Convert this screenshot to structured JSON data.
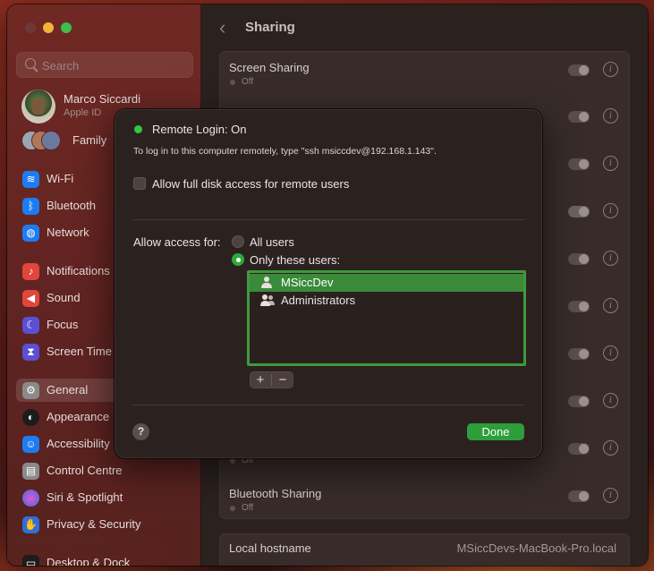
{
  "window": {
    "traffic_lights": [
      "close",
      "minimize",
      "zoom"
    ]
  },
  "sidebar": {
    "search_placeholder": "Search",
    "profile": {
      "name": "Marco Siccardi",
      "subtitle": "Apple ID"
    },
    "family_label": "Family",
    "items": [
      {
        "label": "Wi-Fi",
        "icon": "wifi-icon",
        "color": "#1e7cf2"
      },
      {
        "label": "Bluetooth",
        "icon": "bluetooth-icon",
        "color": "#1e7cf2"
      },
      {
        "label": "Network",
        "icon": "globe-icon",
        "color": "#1e7cf2"
      },
      {
        "label": "Notifications",
        "icon": "bell-icon",
        "color": "#e0463c"
      },
      {
        "label": "Sound",
        "icon": "speaker-icon",
        "color": "#e0463c"
      },
      {
        "label": "Focus",
        "icon": "moon-icon",
        "color": "#5b4fd3"
      },
      {
        "label": "Screen Time",
        "icon": "hourglass-icon",
        "color": "#5b4fd3"
      },
      {
        "label": "General",
        "icon": "gear-icon",
        "color": "#8a8a8a",
        "selected": true
      },
      {
        "label": "Appearance",
        "icon": "appearance-icon",
        "color": "#1c1c1c"
      },
      {
        "label": "Accessibility",
        "icon": "accessibility-icon",
        "color": "#1e7cf2"
      },
      {
        "label": "Control Centre",
        "icon": "control-centre-icon",
        "color": "#8a8a8a"
      },
      {
        "label": "Siri & Spotlight",
        "icon": "siri-icon",
        "color": "#b04bd8"
      },
      {
        "label": "Privacy & Security",
        "icon": "hand-icon",
        "color": "#2f6fd8"
      },
      {
        "label": "Desktop & Dock",
        "icon": "dock-icon",
        "color": "#1c1c1c"
      }
    ]
  },
  "main": {
    "title": "Sharing",
    "rows": [
      {
        "title": "Screen Sharing",
        "status": "Off"
      },
      {
        "title": "",
        "status": ""
      },
      {
        "title": "",
        "status": ""
      },
      {
        "title": "",
        "status": ""
      },
      {
        "title": "",
        "status": ""
      },
      {
        "title": "",
        "status": ""
      },
      {
        "title": "",
        "status": ""
      },
      {
        "title": "",
        "status": ""
      },
      {
        "title": "",
        "status": "Off"
      },
      {
        "title": "Bluetooth Sharing",
        "status": "Off"
      }
    ],
    "hostname_label": "Local hostname",
    "hostname_value": "MSiccDevs-MacBook-Pro.local"
  },
  "dialog": {
    "status_title": "Remote Login: On",
    "status_color": "#2ec841",
    "description": "To log in to this computer remotely, type \"ssh msiccdev@192.168.1.143\".",
    "full_disk_label": "Allow full disk access for remote users",
    "full_disk_checked": false,
    "access_label": "Allow access for:",
    "option_all": "All users",
    "option_only": "Only these users:",
    "selected_option": "Only these users:",
    "users": [
      {
        "name": "MSiccDev",
        "icon": "user-icon",
        "selected": true
      },
      {
        "name": "Administrators",
        "icon": "group-icon",
        "selected": false
      }
    ],
    "add_label": "+",
    "remove_label": "−",
    "help_label": "?",
    "done_label": "Done",
    "accent_color": "#2e9e3a"
  }
}
